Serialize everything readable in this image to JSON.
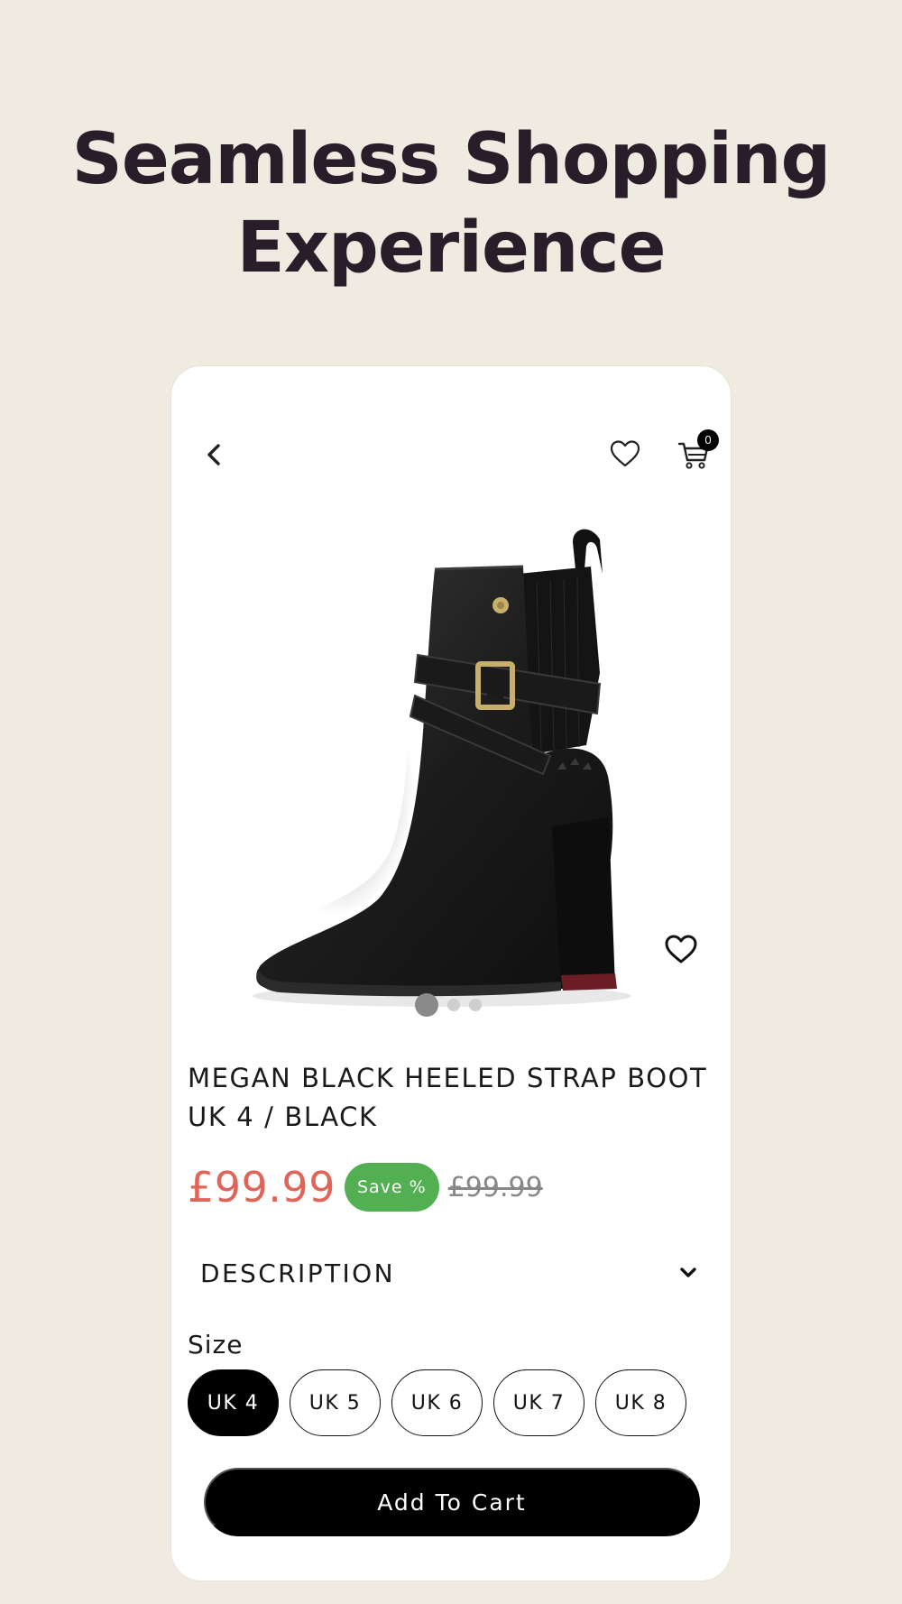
{
  "hero": {
    "line1": "Seamless Shopping",
    "line2": "Experience"
  },
  "header": {
    "back_icon": "chevron-left-icon",
    "wishlist_icon": "heart-icon",
    "cart_icon": "cart-icon",
    "cart_count": "0"
  },
  "gallery": {
    "image": "black-heeled-strap-boot",
    "wishlist_icon": "heart-icon",
    "dot_count": 3,
    "active_dot": 0
  },
  "product": {
    "title": "MEGAN BLACK HEELED STRAP BOOT UK 4 / BLACK",
    "price": "£99.99",
    "save_badge": "Save %",
    "compare_price": "£99.99",
    "price_color": "#e06558",
    "badge_color": "#52af52"
  },
  "description": {
    "label": "DESCRIPTION",
    "icon": "chevron-down-icon"
  },
  "size": {
    "label": "Size",
    "options": [
      "UK 4",
      "UK 5",
      "UK 6",
      "UK 7",
      "UK 8"
    ],
    "selected": "UK 4"
  },
  "cta": {
    "add_to_cart": "Add To Cart"
  },
  "colors": {
    "page_bg": "#efebe1",
    "headline": "#2a1d2a",
    "primary": "#000000"
  }
}
